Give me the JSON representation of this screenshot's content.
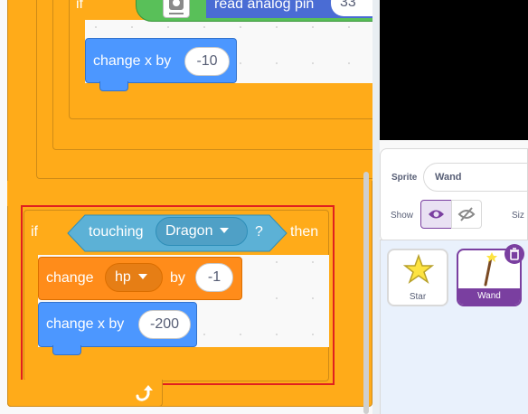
{
  "script": {
    "top_if_label": "if",
    "read_analog_label": "read analog pin",
    "read_analog_pin": "33",
    "change_x_top": {
      "label": "change x by",
      "value": "-10"
    },
    "if_block": {
      "if_label": "if",
      "touching_label": "touching",
      "touching_target": "Dragon",
      "question": "?",
      "then_label": "then"
    },
    "change_var": {
      "label": "change",
      "var": "hp",
      "by_label": "by",
      "value": "-1"
    },
    "change_x_bottom": {
      "label": "change x by",
      "value": "-200"
    }
  },
  "sprite_info": {
    "sprite_label": "Sprite",
    "sprite_name": "Wand",
    "show_label": "Show",
    "size_label": "Siz"
  },
  "sprites": [
    {
      "name": "Star",
      "selected": false
    },
    {
      "name": "Wand",
      "selected": true
    }
  ],
  "colors": {
    "control": "#ffab19",
    "motion": "#4c97ff",
    "variables": "#ff8c1a",
    "sensing": "#5cb1d6",
    "extension": "#59c059",
    "selection": "#7a3fa0",
    "highlight": "#e02020"
  },
  "icons": [
    "chip-icon",
    "eye-icon",
    "eye-slash-icon",
    "trash-icon",
    "star-icon",
    "wand-icon",
    "loop-arrow-icon"
  ]
}
